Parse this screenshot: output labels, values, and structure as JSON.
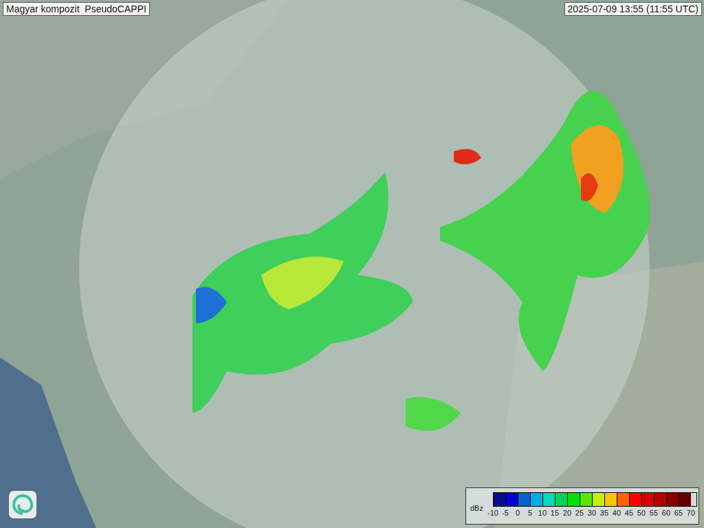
{
  "title": "Magyar kompozit  PseudoCAPPI",
  "timestamp": "2025-07-09 13:55 (11:55 UTC)",
  "legend": {
    "unit": "dBz",
    "bins": [
      {
        "color": "#0a0a8c"
      },
      {
        "color": "#0000d2"
      },
      {
        "color": "#0a5fd6"
      },
      {
        "color": "#00b0dc"
      },
      {
        "color": "#00dcb4"
      },
      {
        "color": "#00d25a"
      },
      {
        "color": "#00e100"
      },
      {
        "color": "#5ae600"
      },
      {
        "color": "#c8f000"
      },
      {
        "color": "#f5c800"
      },
      {
        "color": "#ff6400"
      },
      {
        "color": "#ff0000"
      },
      {
        "color": "#d70000"
      },
      {
        "color": "#b40000"
      },
      {
        "color": "#8c0000"
      },
      {
        "color": "#640000"
      }
    ],
    "ticks": [
      "-10",
      "-5",
      "0",
      "5",
      "10",
      "15",
      "20",
      "25",
      "30",
      "35",
      "40",
      "45",
      "50",
      "55",
      "60",
      "65",
      "70"
    ]
  }
}
